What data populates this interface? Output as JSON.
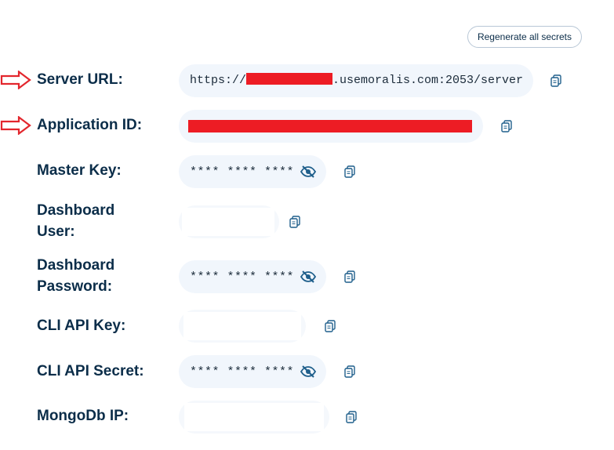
{
  "actions": {
    "regenerate_label": "Regenerate all secrets"
  },
  "fields": {
    "server_url": {
      "label": "Server URL:",
      "value_prefix": "https://",
      "value_suffix": ".usemoralis.com:2053/server"
    },
    "application_id": {
      "label": "Application ID:"
    },
    "master_key": {
      "label": "Master Key:",
      "masked_value": "**** **** ****"
    },
    "dashboard_user": {
      "label_line1": "Dashboard",
      "label_line2": "User:"
    },
    "dashboard_password": {
      "label_line1": "Dashboard",
      "label_line2": "Password:",
      "masked_value": "**** **** ****"
    },
    "cli_api_key": {
      "label": "CLI API Key:"
    },
    "cli_api_secret": {
      "label": "CLI API Secret:",
      "masked_value": "**** **** ****"
    },
    "mongodb_ip": {
      "label": "MongoDb IP:"
    }
  },
  "colors": {
    "label_text": "#0b2d49",
    "pill_background": "#f1f6fc",
    "redaction": "#ed1c24",
    "annotation_arrow": "#e3262d",
    "icon": "#1f5f8b"
  },
  "icons": {
    "copy": "copy-icon",
    "eye_hidden": "eye-slash-icon",
    "annotation": "arrow-right-outline-icon"
  }
}
